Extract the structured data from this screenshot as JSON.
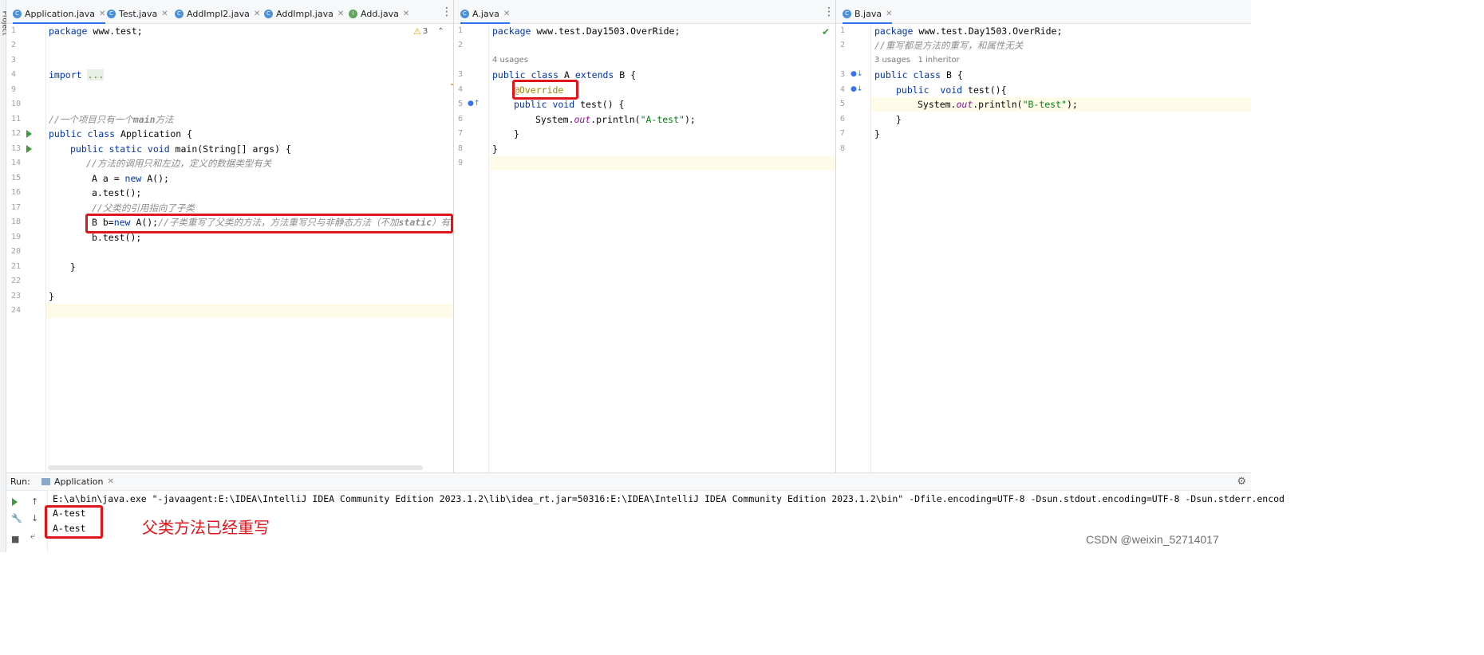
{
  "side": {
    "project_label": "Project",
    "commit_label": "Commit"
  },
  "pane1": {
    "tabs": [
      {
        "label": "Application.java",
        "icon": "C"
      },
      {
        "label": "Test.java",
        "icon": "C"
      },
      {
        "label": "AddImpl2.java",
        "icon": "C"
      },
      {
        "label": "AddImpl.java",
        "icon": "C"
      },
      {
        "label": "Add.java",
        "icon": "I"
      }
    ],
    "warning_count": "3",
    "line_numbers": [
      "1",
      "2",
      "3",
      "4",
      "9",
      "10",
      "11",
      "12",
      "13",
      "14",
      "15",
      "16",
      "17",
      "18",
      "19",
      "20",
      "21",
      "22",
      "23",
      "24"
    ],
    "lines": {
      "l1_kw": "package",
      "l1_rest": " www.test;",
      "l4_kw": "import",
      "l4_fold": "...",
      "l11_cmt_a": "//一个项目只有一个",
      "l11_cmt_b": "main",
      "l11_cmt_c": "方法",
      "l12_kw": "public class",
      "l12_rest": " Application {",
      "l13_kw": "public static void",
      "l13_rest": " main(String[] args) {",
      "l14": "//方法的调用只和左边，定义的数据类型有关",
      "l15_a": "A a = ",
      "l15_kw": "new",
      "l15_b": " A();",
      "l16": "a.test();",
      "l17": "//父类的引用指向了子类",
      "l18_a": "B b=",
      "l18_kw": "new",
      "l18_b": " A();",
      "l18_cmt_a": "//子类重写了父类的方法，方法重写只与非静态方法（不加",
      "l18_cmt_b": "static",
      "l18_cmt_c": "）有关",
      "l19": "b.test();",
      "l21": "}",
      "l23": "}"
    }
  },
  "pane2": {
    "tabs": [
      {
        "label": "A.java",
        "icon": "C"
      }
    ],
    "usages": "4 usages",
    "line_numbers": [
      "1",
      "2",
      "3",
      "4",
      "5",
      "6",
      "7",
      "8",
      "9"
    ],
    "lines": {
      "l1_kw": "package",
      "l1_rest": " www.test.Day1503.OverRide;",
      "l3_kw1": "public class",
      "l3_a": " A ",
      "l3_kw2": "extends",
      "l3_b": " B {",
      "l4": "@Override",
      "l5_kw": "public void",
      "l5_rest": " test() {",
      "l6_a": "System.",
      "l6_fld": "out",
      "l6_b": ".println(",
      "l6_str": "\"A-test\"",
      "l6_c": ");",
      "l7": "}",
      "l8": "}"
    }
  },
  "pane3": {
    "tabs": [
      {
        "label": "B.java",
        "icon": "C"
      }
    ],
    "usages": "3 usages",
    "inheritors": "1 inheritor",
    "line_numbers": [
      "1",
      "2",
      "3",
      "4",
      "5",
      "6",
      "7",
      "8"
    ],
    "lines": {
      "l1_kw": "package",
      "l1_rest": " www.test.Day1503.OverRide;",
      "l2": "//重写都是方法的重写，和属性无关",
      "l3_kw": "public class",
      "l3_rest": " B {",
      "l4_kw1": "public",
      "l4_kw2": "void",
      "l4_rest": " test(){",
      "l5_a": "System.",
      "l5_fld": "out",
      "l5_b": ".println(",
      "l5_str": "\"B-test\"",
      "l5_c": ");",
      "l6": "}",
      "l7": "}"
    }
  },
  "run": {
    "label": "Run:",
    "tab": "Application",
    "command": "E:\\a\\bin\\java.exe \"-javaagent:E:\\IDEA\\IntelliJ IDEA Community Edition 2023.1.2\\lib\\idea_rt.jar=50316:E:\\IDEA\\IntelliJ IDEA Community Edition 2023.1.2\\bin\" -Dfile.encoding=UTF-8 -Dsun.stdout.encoding=UTF-8 -Dsun.stderr.encod",
    "output": [
      "A-test",
      "A-test"
    ],
    "annotation": "父类方法已经重写",
    "watermark": "CSDN @weixin_52714017"
  },
  "colors": {
    "highlight_box": "#e0141a",
    "keyword": "#0033b3",
    "comment": "#8c8c8c",
    "string": "#067d17"
  }
}
